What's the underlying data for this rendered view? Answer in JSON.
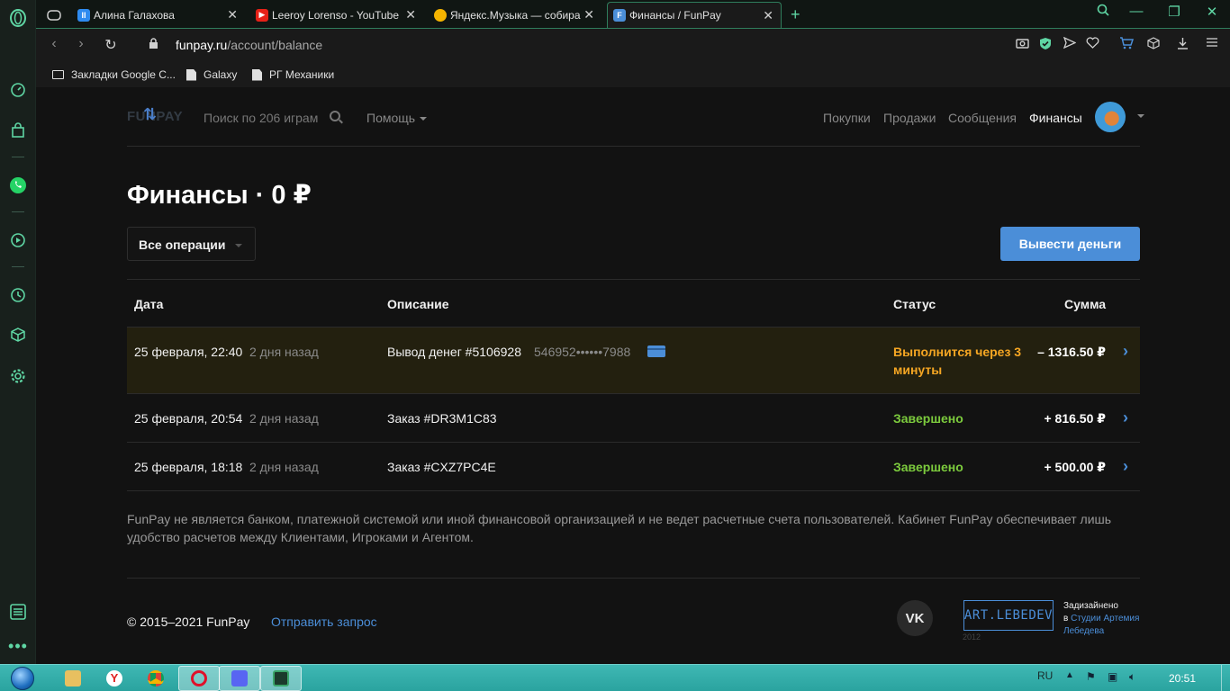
{
  "browser": {
    "tabs": [
      {
        "title": "Алина Галахова",
        "favicon_color": "#2e8bf0"
      },
      {
        "title": "Leeroy Lorenso - YouTube",
        "favicon_color": "#e62117"
      },
      {
        "title": "Яндекс.Музыка — собирае",
        "favicon_color": "#f5b400"
      },
      {
        "title": "Финансы / FunPay",
        "favicon_color": "#4b8ed8",
        "active": true
      }
    ],
    "new_tab": "+",
    "address": {
      "host": "funpay.ru",
      "path": "/account/balance"
    },
    "bookmarks": [
      {
        "label": "Закладки Google C...",
        "icon": "folder-icon"
      },
      {
        "label": "Galaxy",
        "icon": "document-icon"
      },
      {
        "label": "РГ Механики",
        "icon": "document-icon"
      }
    ]
  },
  "header": {
    "logo": "FUNPAY",
    "search_placeholder": "Поиск по 206 играм",
    "help": "Помощь",
    "nav": [
      "Покупки",
      "Продажи",
      "Сообщения",
      "Финансы"
    ]
  },
  "page": {
    "title": "Финансы · 0 ₽",
    "filter": "Все операции",
    "withdraw_button": "Вывести деньги"
  },
  "table": {
    "columns": {
      "date": "Дата",
      "description": "Описание",
      "status": "Статус",
      "amount": "Сумма"
    },
    "rows": [
      {
        "date": "25 февраля, 22:40",
        "ago": "2 дня назад",
        "description": "Вывод денег #5106928",
        "card": "546952••••••7988",
        "status": "Выполнится через 3 минуты",
        "amount": "– 1316.50 ₽",
        "state": "pending"
      },
      {
        "date": "25 февраля, 20:54",
        "ago": "2 дня назад",
        "description": "Заказ #DR3M1C83",
        "status": "Завершено",
        "amount": "+ 816.50 ₽",
        "state": "done"
      },
      {
        "date": "25 февраля, 18:18",
        "ago": "2 дня назад",
        "description": "Заказ #CXZ7PC4E",
        "status": "Завершено",
        "amount": "+ 500.00 ₽",
        "state": "done"
      }
    ]
  },
  "disclaimer": "FunPay не является банком, платежной системой или иной финансовой организацией и не ведет расчетные счета пользователей. Кабинет FunPay обеспечивает лишь удобство расчетов между Клиентами, Игроками и Агентом.",
  "footer": {
    "copyright": "© 2015–2021 FunPay",
    "request": "Отправить запрос",
    "vk": "VK",
    "lebedev": "ART.LEBEDEV",
    "lebedev_year": "2012",
    "designed_line1": "Задизайнено",
    "designed_prefix": "в",
    "designed_link1": "Студии Артемия",
    "designed_link2": "Лебедева"
  },
  "taskbar": {
    "lang": "RU",
    "time": "20:51"
  },
  "colors": {
    "accent": "#4b8ed8",
    "pending": "#f5a623",
    "done": "#7ccb3d",
    "opera_green": "#5fd6a4"
  }
}
